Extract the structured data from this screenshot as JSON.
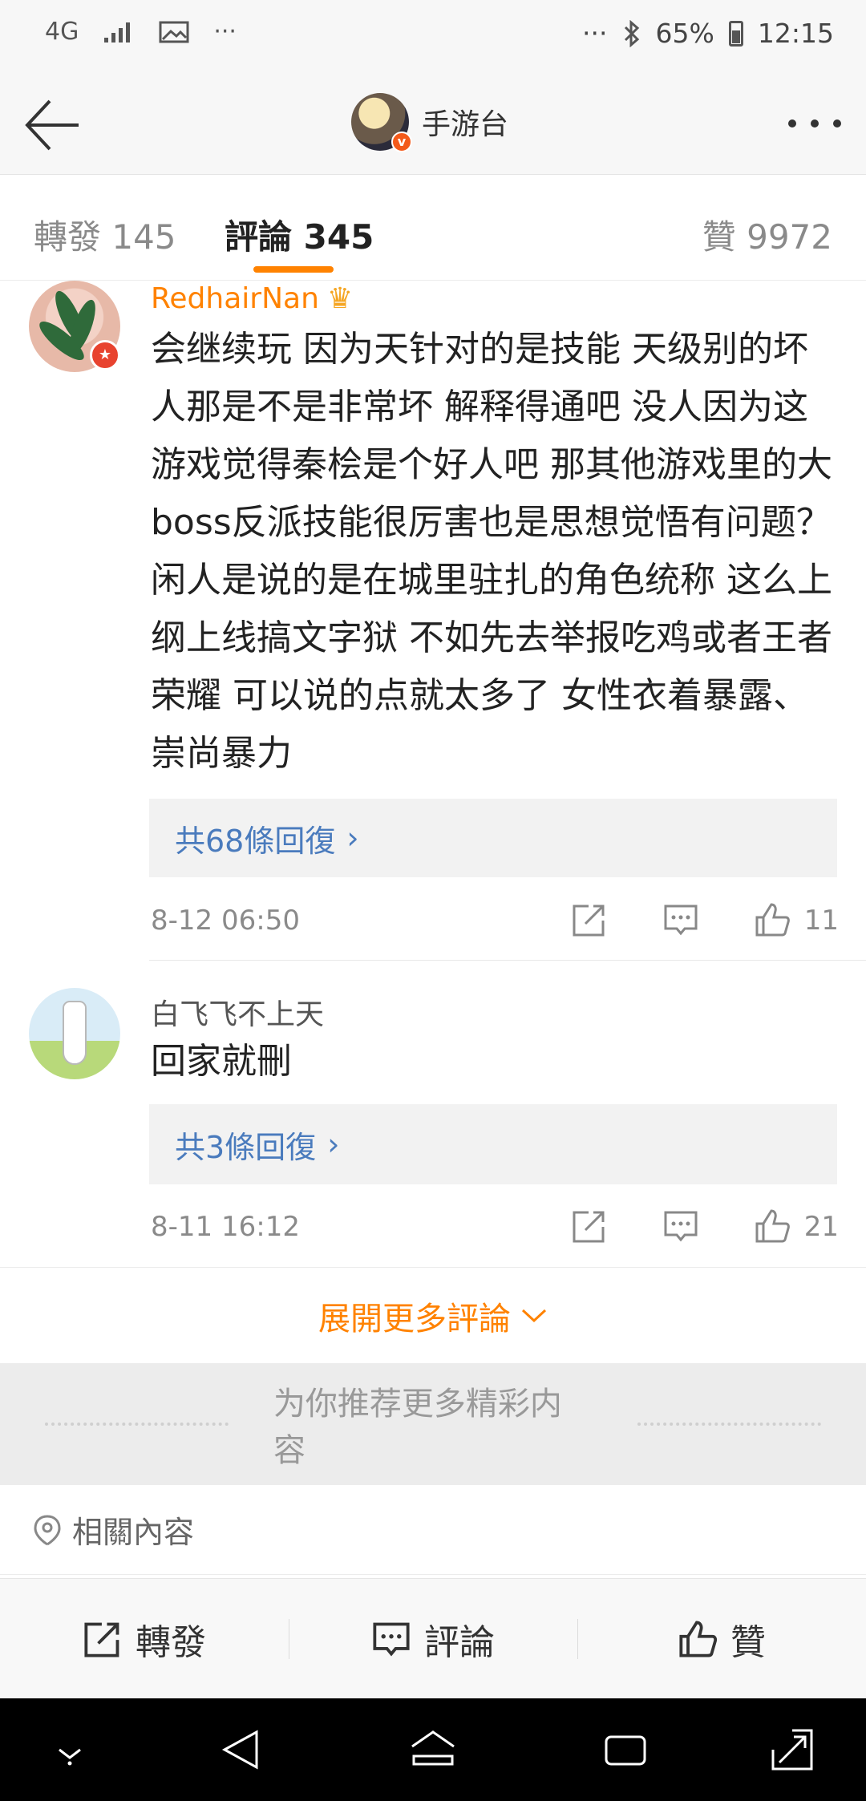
{
  "status_bar": {
    "network": "4G",
    "battery": "65%",
    "time": "12:15",
    "more": "···"
  },
  "header": {
    "title": "手游台"
  },
  "tabs": {
    "repost": "轉發 145",
    "comments": "評論 345",
    "likes": "贊 9972"
  },
  "comments": [
    {
      "username": "RedhairNan",
      "text": "会继续玩 因为天针对的是技能 天级别的坏人那是不是非常坏 解释得通吧 没人因为这游戏觉得秦桧是个好人吧 那其他游戏里的大boss反派技能很厉害也是思想觉悟有问题？ 闲人是说的是在城里驻扎的角色统称 这么上纲上线搞文字狱 不如先去举报吃鸡或者王者荣耀 可以说的点就太多了 女性衣着暴露、崇尚暴力",
      "replies": "共68條回復",
      "time": "8-12 06:50",
      "likes": "11"
    },
    {
      "username": "白飞飞不上天",
      "text": "回家就刪",
      "replies": "共3條回復",
      "time": "8-11 16:12",
      "likes": "21"
    }
  ],
  "expand_label": "展開更多評論",
  "recommend_label": "为你推荐更多精彩内容",
  "related_label": "相關內容",
  "bottom_bar": {
    "repost": "轉發",
    "comment": "評論",
    "like": "贊"
  },
  "colors": {
    "accent": "#ff8200",
    "link": "#4a7bbd"
  }
}
